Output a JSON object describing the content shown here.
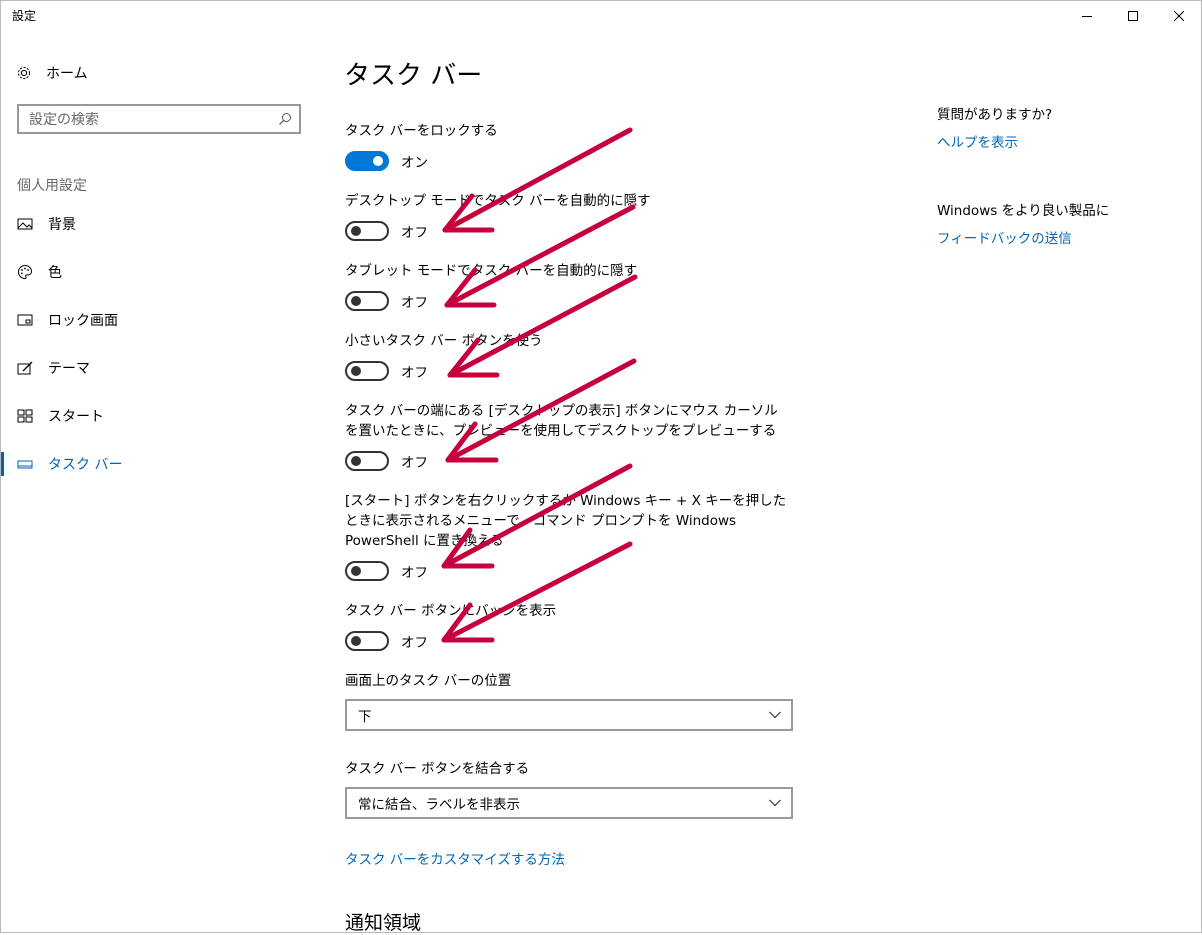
{
  "window": {
    "title": "設定",
    "minimize_icon": "minimize-icon",
    "maximize_icon": "maximize-icon",
    "close_icon": "close-icon"
  },
  "sidebar": {
    "home_label": "ホーム",
    "search_placeholder": "設定の検索",
    "section_label": "個人用設定",
    "items": [
      {
        "label": "背景",
        "icon": "picture-icon"
      },
      {
        "label": "色",
        "icon": "palette-icon"
      },
      {
        "label": "ロック画面",
        "icon": "lock-screen-icon"
      },
      {
        "label": "テーマ",
        "icon": "theme-icon"
      },
      {
        "label": "スタート",
        "icon": "start-icon"
      },
      {
        "label": "タスク バー",
        "icon": "taskbar-icon",
        "active": true
      }
    ]
  },
  "main": {
    "title": "タスク バー",
    "settings": [
      {
        "label": "タスク バーをロックする",
        "state": "オン",
        "on": true
      },
      {
        "label": "デスクトップ モードでタスク バーを自動的に隠す",
        "state": "オフ",
        "on": false
      },
      {
        "label": "タブレット モードでタスク バーを自動的に隠す",
        "state": "オフ",
        "on": false
      },
      {
        "label": "小さいタスク バー ボタンを使う",
        "state": "オフ",
        "on": false
      },
      {
        "label": "タスク バーの端にある [デスクトップの表示] ボタンにマウス カーソルを置いたときに、プレビューを使用してデスクトップをプレビューする",
        "state": "オフ",
        "on": false
      },
      {
        "label": "[スタート] ボタンを右クリックするか Windows キー + X キーを押したときに表示されるメニューで、コマンド プロンプトを Windows PowerShell に置き換える",
        "state": "オフ",
        "on": false
      },
      {
        "label": "タスク バー ボタンにバッジを表示",
        "state": "オフ",
        "on": false
      }
    ],
    "position_label": "画面上のタスク バーの位置",
    "position_value": "下",
    "combine_label": "タスク バー ボタンを結合する",
    "combine_value": "常に結合、ラベルを非表示",
    "customize_link": "タスク バーをカスタマイズする方法",
    "notification_title": "通知領域"
  },
  "right": {
    "help_question": "質問がありますか?",
    "help_link": "ヘルプを表示",
    "feedback_question": "Windows をより良い製品に",
    "feedback_link": "フィードバックの送信"
  },
  "colors": {
    "accent": "#0078d7",
    "link": "#0067b8",
    "annotation_arrow": "#c5003c"
  }
}
